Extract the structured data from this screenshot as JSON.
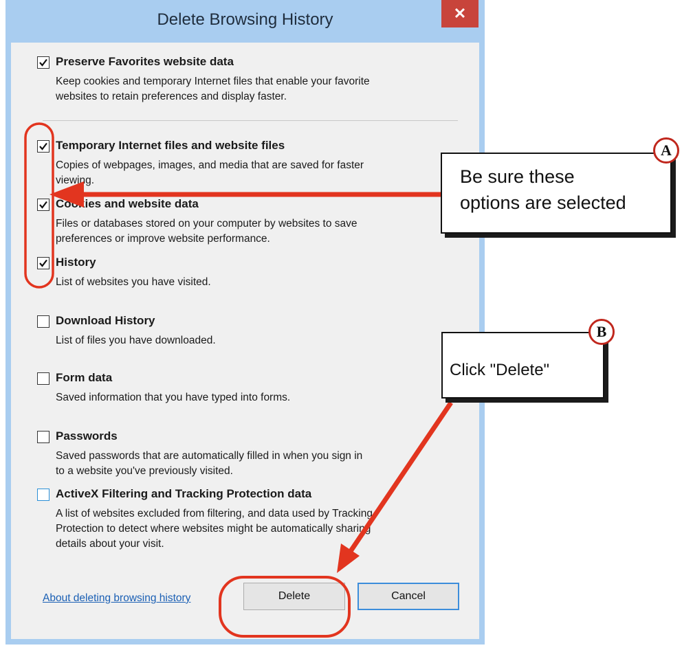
{
  "dialog": {
    "title": "Delete Browsing History",
    "close_glyph": "✕"
  },
  "options": [
    {
      "title": "Preserve Favorites website data",
      "checked": true,
      "desc_lines": [
        "Keep cookies and temporary Internet files that enable your favorite",
        "websites to retain preferences and display faster."
      ]
    },
    {
      "title": "Temporary Internet files and website files",
      "checked": true,
      "desc_lines": [
        "Copies of webpages, images, and media that are saved for faster",
        "viewing."
      ]
    },
    {
      "title": "Cookies and website data",
      "checked": true,
      "desc_lines": [
        "Files or databases stored on your computer by websites to save",
        "preferences or improve website performance."
      ]
    },
    {
      "title": "History",
      "checked": true,
      "desc_lines": [
        "List of websites you have visited."
      ]
    },
    {
      "title": "Download History",
      "checked": false,
      "desc_lines": [
        "List of files you have downloaded."
      ]
    },
    {
      "title": "Form data",
      "checked": false,
      "desc_lines": [
        "Saved information that you have typed into forms."
      ]
    },
    {
      "title": "Passwords",
      "checked": false,
      "desc_lines": [
        "Saved passwords that are automatically filled in when you sign in",
        "to a website you've previously visited."
      ]
    },
    {
      "title": "ActiveX Filtering and Tracking Protection data",
      "checked": false,
      "desc_lines": [
        "A list of websites excluded from filtering, and data used by Tracking",
        "Protection to detect where websites might be automatically sharing",
        "details about your visit."
      ]
    }
  ],
  "footer": {
    "link": "About deleting browsing history",
    "delete_label": "Delete",
    "cancel_label": "Cancel"
  },
  "annotations": {
    "a_badge": "A",
    "a_text_line1": "Be sure these",
    "a_text_line2": "options are selected",
    "b_badge": "B",
    "b_text": "Click \"Delete\""
  },
  "colors": {
    "title_bar": "#a9cdf0",
    "close_button": "#c8443b",
    "annotation_red": "#e2351f",
    "link": "#1a5fb4",
    "cancel_border": "#3c8ddb"
  }
}
